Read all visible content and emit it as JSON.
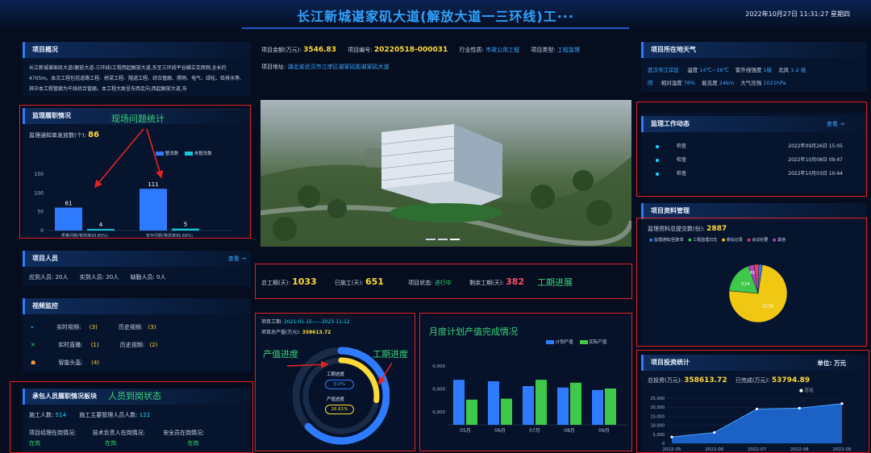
{
  "header": {
    "title": "长江新城谌家矶大道(解放大道一三环线)工···",
    "datetime": "2022年10月27日 11:31:27 星期四"
  },
  "overview": {
    "title": "项目概况",
    "text": "长江新城谌家矶大道(解放大道-三环线)工程西起解放大道,东至三环线平谷辅立交西侧,全长约4705m。本次工程包括道路工程、桥梁工程、隧道工程、综合管廊、照明、电气、绿化、给排水等,其中本工程管廊为干线综合管廊。本工程大致呈东西走向,西起解放大道,东"
  },
  "supervision": {
    "title": "监理履职情况",
    "notice_label": "监理通知单发放数(个):",
    "notice_value": "86",
    "legend": [
      "整改数",
      "未整改数"
    ],
    "yticks": [
      "150",
      "100",
      "50",
      "0"
    ],
    "bars": [
      {
        "rectified": 61,
        "unrectified": 4,
        "label": "质量问题(整改率93.85%)"
      },
      {
        "rectified": 111,
        "unrectified": 5,
        "label": "安全问题(整改率95.69%)"
      }
    ]
  },
  "personnel": {
    "title": "项目人员",
    "more": "查看 →",
    "should": "应到人员: 20人",
    "actual": "实到人员: 20人",
    "missing": "缺勤人员: 0人"
  },
  "video": {
    "title": "视频监控",
    "rows": [
      {
        "a_label": "实时视频:",
        "a_val": "(3)",
        "b_label": "历史视频:",
        "b_val": "(3)"
      },
      {
        "a_label": "实时直播:",
        "a_val": "(1)",
        "b_label": "历史视频:",
        "b_val": "(2)"
      },
      {
        "a_label": "智能头盔:",
        "a_val": "(4)"
      }
    ]
  },
  "contractor": {
    "title": "承包人员履职情况板块",
    "workers_label": "施工人数:",
    "workers_val": "514",
    "managers_label": "施工主要管理人员人数:",
    "managers_val": "122",
    "status": [
      {
        "label": "项目经理在岗情况:",
        "val": "在岗"
      },
      {
        "label": "技术负责人在岗情况:",
        "val": "在岗"
      },
      {
        "label": "安全员在岗情况:",
        "val": "在岗"
      }
    ]
  },
  "info": {
    "amount_label": "项目金额(万元):",
    "amount": "3546.83",
    "code_label": "项目编号:",
    "code": "20220518-000031",
    "industry_label": "行业性质:",
    "industry": "市政公用工程",
    "type_label": "项目类型:",
    "type": "工程监理",
    "address_label": "项目地址:",
    "address": "湖北省武汉市江岸区谌家矶街谌家矶大道"
  },
  "schedule": {
    "total_label": "总工期(天):",
    "total": "1033",
    "done_label": "已施工(天):",
    "done": "651",
    "status_label": "项目状态:",
    "status": "进行中",
    "remain_label": "剩余工期(天):",
    "remain": "382"
  },
  "gauge": {
    "period_label": "项目工期:",
    "period": "2021-01-15——2023-11-12",
    "output_label": "项目总产值(万元):",
    "output": "358613.72",
    "inner_label": "工期进度",
    "inner_val": "0.0%",
    "outer_label": "产值进度",
    "outer_val": "26.61%",
    "schedule_frac": 0.63,
    "output_frac": 0.27
  },
  "monthly": {
    "legend": [
      "计划产值",
      "实际产值"
    ],
    "yticks": [
      "0,000",
      "0,000",
      "0,000"
    ]
  },
  "weather": {
    "title": "项目所在地天气",
    "location": "武汉市江岸区",
    "temp_label": "温度",
    "temp": "14℃~16℃",
    "uv_label": "紫外线强度",
    "uv": "1级",
    "wind_label": "北风",
    "wind": "1-2 级",
    "sky": "阴",
    "humidity_label": "相对湿度",
    "humidity": "78%",
    "vis_label": "能见度",
    "vis": "24km",
    "pressure_label": "大气压强",
    "pressure": "1021hPa"
  },
  "dynamics": {
    "title": "监理工作动态",
    "more": "查看 →",
    "items": [
      {
        "type": "检查",
        "time": "2022年09月26日 15:05"
      },
      {
        "type": "检查",
        "time": "2022年10月08日 09:47"
      },
      {
        "type": "检查",
        "time": "2022年10月03日 10:44"
      }
    ]
  },
  "materials": {
    "title": "项目资料管理",
    "count_label": "监理资料总提交数(份):",
    "count": "2887",
    "legend": [
      "监理通知/回复单",
      "工程监理日志",
      "旁站记录",
      "会议纪要",
      "其他"
    ]
  },
  "investment": {
    "title": "项目投资统计",
    "unit": "单位: 万元",
    "total_label": "总投资(万元):",
    "total": "358613.72",
    "done_label": "已完成(万元):",
    "done": "53794.89",
    "legend": "万元",
    "yticks": [
      "25,000",
      "20,000",
      "15,000",
      "10,000",
      "5,000",
      "0"
    ],
    "xlabels": [
      "2022-05",
      "2022-06",
      "2022-07",
      "2022-08",
      "2022-09"
    ]
  },
  "annotations": {
    "issues": "现场问题统计",
    "period": "工期进展",
    "output": "产值进度",
    "progress": "工期进度",
    "monthly": "月度计划产值完成情况",
    "personnel": "人员到岗状态"
  },
  "chart_data": [
    {
      "type": "bar",
      "categories": [
        "质量问题(整改率93.85%)",
        "安全问题(整改率95.69%)"
      ],
      "series": [
        {
          "name": "整改数",
          "values": [
            61,
            111
          ]
        },
        {
          "name": "未整改数",
          "values": [
            4,
            5
          ]
        }
      ],
      "ylim": [
        0,
        150
      ]
    },
    {
      "type": "bar",
      "categories": [
        "05月",
        "06月",
        "07月",
        "08月",
        "09月"
      ],
      "series": [
        {
          "name": "计划产值",
          "values": [
            0.93,
            0.9,
            0.8,
            0.77,
            0.72
          ]
        },
        {
          "name": "实际产值",
          "values": [
            0.52,
            0.54,
            0.93,
            0.87,
            0.75
          ]
        }
      ]
    },
    {
      "type": "pie",
      "slices": [
        {
          "label": "",
          "value": 2138,
          "color": "#f0c712"
        },
        {
          "label": "",
          "value": 524,
          "color": "#3ec94a"
        },
        {
          "label": "",
          "value": 89,
          "color": "#b447c9"
        },
        {
          "label": "",
          "value": 80,
          "color": "#e0415e"
        },
        {
          "label": "",
          "value": 56,
          "color": "#2f7bff"
        }
      ]
    },
    {
      "type": "area",
      "x": [
        "2022-05",
        "2022-06",
        "2022-07",
        "2022-08",
        "2022-09"
      ],
      "values": [
        3500,
        6000,
        19000,
        19500,
        22000
      ],
      "ylim": [
        0,
        25000
      ]
    }
  ]
}
